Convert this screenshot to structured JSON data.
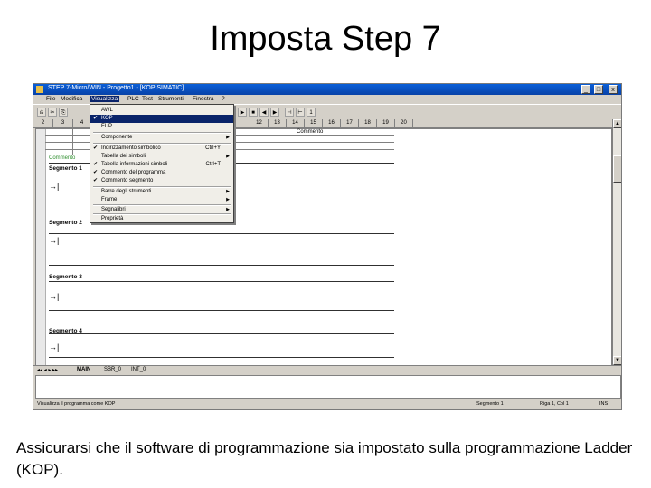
{
  "slide": {
    "title": "Imposta Step 7",
    "caption": "Assicurarsi che il software di programmazione sia impostato sulla programmazione Ladder (KOP)."
  },
  "window": {
    "title": "STEP 7-Micro/WIN - Progetto1 - [KOP SIMATIC]",
    "minimize": "_",
    "maximize": "□",
    "close": "x"
  },
  "menubar": {
    "items": [
      "File",
      "Modifica",
      "Visualizza",
      "PLC",
      "Test",
      "Strumenti",
      "Finestra",
      "?"
    ]
  },
  "toolbar": {
    "buttons": [
      "⎌",
      "✂",
      "⎘",
      "▶",
      "■",
      "◀",
      "▶",
      "⊣",
      "⊢",
      "1"
    ]
  },
  "ruler": {
    "cells": [
      "2",
      "3",
      "4",
      "12",
      "13",
      "14",
      "15",
      "16",
      "17",
      "18",
      "19",
      "20"
    ]
  },
  "editor": {
    "comment_header": "Commento",
    "segments": [
      {
        "label": "Segmento 1",
        "comment": "Commento"
      },
      {
        "label": "Segmento 2",
        "comment": ""
      },
      {
        "label": "Segmento 3",
        "comment": ""
      },
      {
        "label": "Segmento 4",
        "comment": ""
      }
    ],
    "contact_glyph": "→|"
  },
  "dropdown": {
    "items": [
      {
        "label": "AWL",
        "check": "",
        "shortcut": "",
        "submenu": false
      },
      {
        "label": "KOP",
        "check": "✔",
        "shortcut": "",
        "submenu": false,
        "highlighted": true
      },
      {
        "label": "FUP",
        "check": "",
        "shortcut": "",
        "submenu": false
      },
      {
        "label": "Componente",
        "check": "",
        "shortcut": "",
        "submenu": true
      },
      {
        "label": "Indirizzamento simbolico",
        "check": "✔",
        "shortcut": "Ctrl+Y",
        "submenu": false
      },
      {
        "label": "Tabella dei simboli",
        "check": "",
        "shortcut": "",
        "submenu": true
      },
      {
        "label": "Tabella informazioni simboli",
        "check": "✔",
        "shortcut": "Ctrl+T",
        "submenu": false
      },
      {
        "label": "Commento del programma",
        "check": "✔",
        "shortcut": "",
        "submenu": false
      },
      {
        "label": "Commento segmento",
        "check": "✔",
        "shortcut": "",
        "submenu": false
      },
      {
        "label": "Barre degli strumenti",
        "check": "",
        "shortcut": "",
        "submenu": true
      },
      {
        "label": "Frame",
        "check": "",
        "shortcut": "",
        "submenu": true
      },
      {
        "label": "Segnalibri",
        "check": "",
        "shortcut": "",
        "submenu": true
      },
      {
        "label": "Proprietà",
        "check": "",
        "shortcut": "",
        "submenu": false
      }
    ]
  },
  "tabs": {
    "items": [
      "MAIN",
      "SBR_0",
      "INT_0"
    ]
  },
  "statusbar": {
    "ready": "Visualizza il programma come KOP",
    "position": "Segmento 1",
    "row": "Riga 1, Col 1",
    "mode": "INS"
  },
  "colors": {
    "title_bar": "#0842a8",
    "menu_highlight": "#0a246a",
    "comment_green": "#2f8f2f"
  }
}
